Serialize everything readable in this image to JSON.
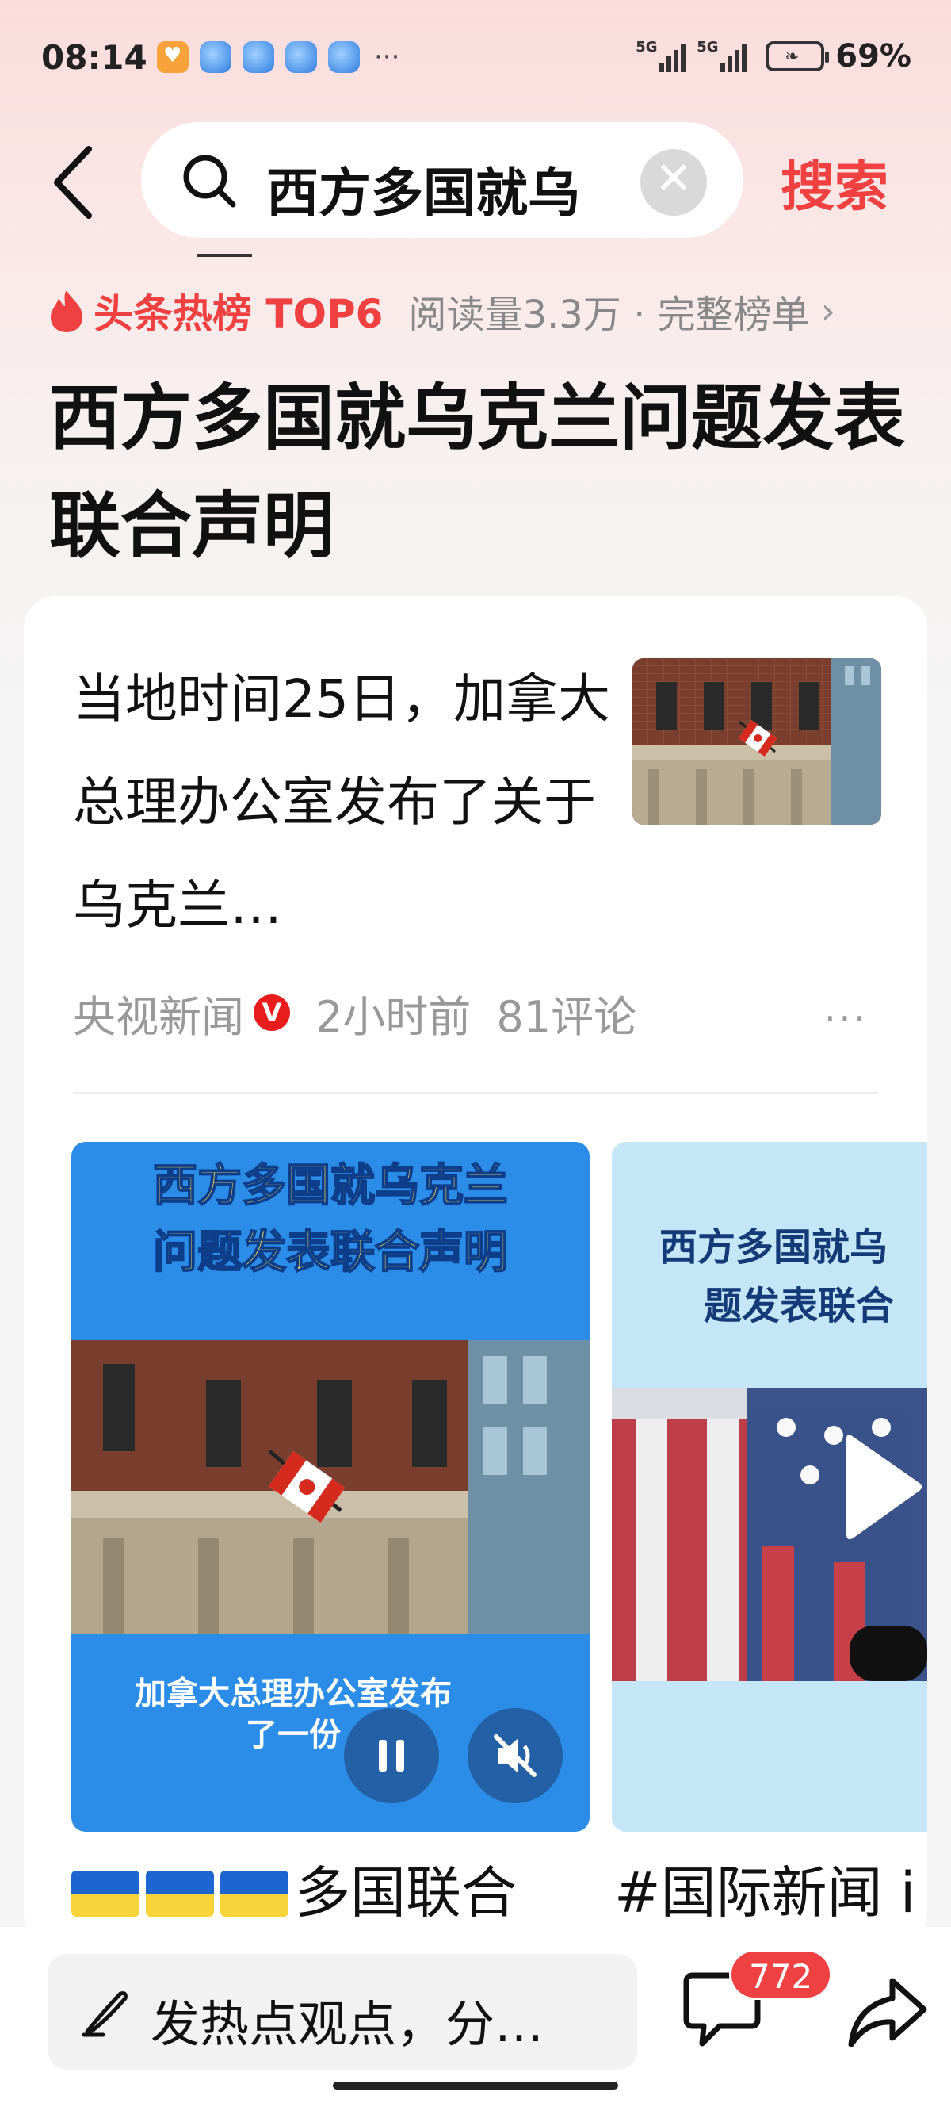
{
  "status_bar": {
    "time": "08:14",
    "more": "···",
    "signal1_label": "5G",
    "signal2_label": "5G",
    "battery": "69%"
  },
  "search": {
    "query": "西方多国就乌",
    "clear_symbol": "✕",
    "submit_label": "搜索"
  },
  "hot": {
    "rank_label": "头条热榜 TOP6",
    "meta": "阅读量3.3万 · 完整榜单",
    "arrow": "›"
  },
  "page_title": "西方多国就乌克兰问题发表联合声明",
  "article": {
    "text": "当地时间25日，加拿大总理办公室发布了关于乌克兰…",
    "source": "央视新闻",
    "verified": "V",
    "time": "2小时前",
    "comments": "81评论",
    "more": "···"
  },
  "videos": [
    {
      "title_line1": "西方多国就乌克兰",
      "title_line2": "问题发表联合声明",
      "caption": "加拿大总理办公室发布了一份",
      "label": "多国联合"
    },
    {
      "title_line1": "西方多国就乌",
      "title_line2": "题发表联合",
      "label": "#国际新闻 i"
    }
  ],
  "bottom": {
    "comment_placeholder": "发热点观点，分…",
    "comment_count": "772"
  },
  "colors": {
    "accent": "#f04142",
    "video_blue": "#2c8de8",
    "video_light": "#c5e6f6"
  }
}
